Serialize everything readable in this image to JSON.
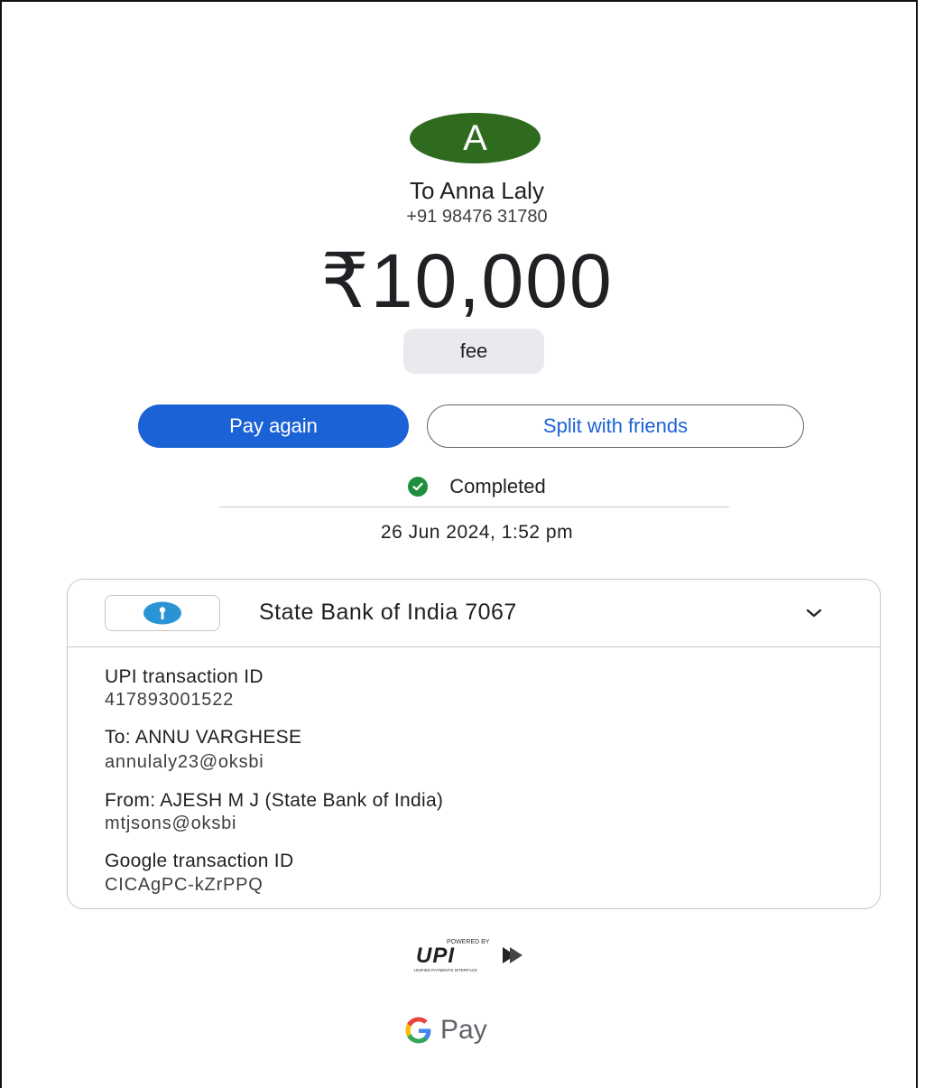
{
  "recipient": {
    "initial": "A",
    "name": "To Anna Laly",
    "phone": "+91 98476 31780"
  },
  "payment": {
    "amount": "₹10,000",
    "note": "fee"
  },
  "actions": {
    "pay_again_label": "Pay again",
    "split_label": "Split with friends"
  },
  "status": {
    "text": "Completed",
    "datetime": "26 Jun 2024, 1:52 pm"
  },
  "card": {
    "bank_name": "State Bank of India 7067",
    "details": [
      {
        "label": "UPI transaction ID",
        "value": "417893001522"
      },
      {
        "label": "To: ANNU  VARGHESE",
        "value": "annulaly23@oksbi"
      },
      {
        "label": "From: AJESH  M J (State Bank of India)",
        "value": "mtjsons@oksbi"
      },
      {
        "label": "Google transaction ID",
        "value": "CICAgPC-kZrPPQ"
      }
    ]
  },
  "footer": {
    "upi_powered_by": "POWERED BY",
    "upi_text": "UPI",
    "upi_subtext": "UNIFIED PAYMENTS INTERFACE",
    "brand_pay": "Pay"
  },
  "colors": {
    "avatar": "#2e6b1f",
    "primary_blue": "#1a62d6",
    "success_green": "#1e8e3e",
    "sbi_blue": "#2a93d5"
  },
  "icons": {
    "status": "check-circle-icon",
    "expand": "chevron-down-icon",
    "bank": "sbi-logo-icon",
    "brand": "google-g-icon"
  }
}
